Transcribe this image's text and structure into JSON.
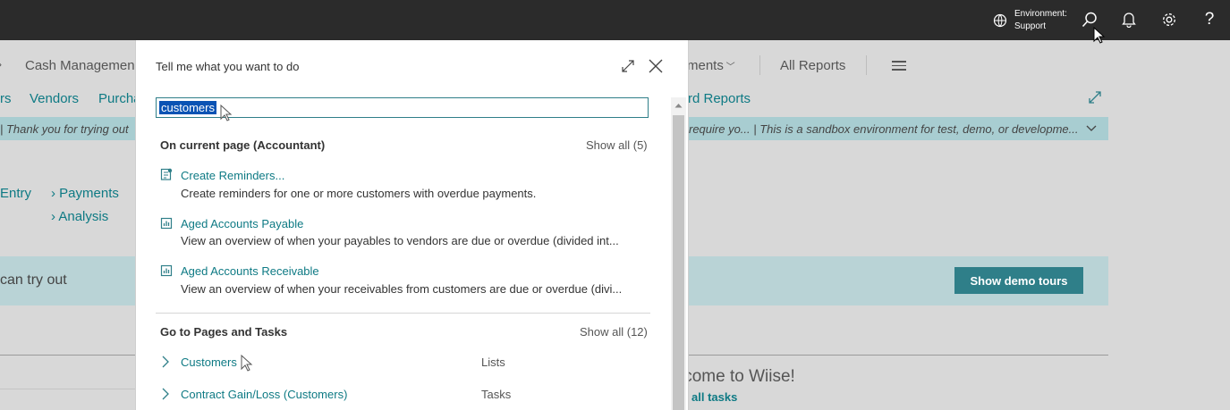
{
  "topbar": {
    "environment_label": "Environment:",
    "environment_value": "Support",
    "icons": [
      "building-icon",
      "search-icon",
      "bell-icon",
      "gear-icon",
      "help-icon"
    ]
  },
  "background": {
    "nav_row1": [
      "Cash Managemen",
      "ments",
      "All Reports"
    ],
    "nav_row2": [
      "rs",
      "Vendors",
      "Purcha",
      "rd Reports"
    ],
    "banner_left": "|  Thank you for trying out",
    "banner_right": "require yo...  |  This is a sandbox environment for test, demo, or developme...",
    "links": [
      "Entry",
      "Payments",
      "Analysis"
    ],
    "demo_text": "can try out",
    "demo_button": "Show demo tours",
    "welcome": "lcome to Wiise!",
    "all_tasks": "all tasks"
  },
  "dialog": {
    "title": "Tell me what you want to do",
    "search_value": "customers",
    "section1": {
      "title": "On current page (Accountant)",
      "show_all": "Show all (5)",
      "results": [
        {
          "title": "Create Reminders...",
          "description": "Create reminders for one or more customers with overdue payments.",
          "icon": "reminder-icon"
        },
        {
          "title": "Aged Accounts Payable",
          "description": "View an overview of when your payables to vendors are due or overdue (divided int...",
          "icon": "report-icon"
        },
        {
          "title": "Aged Accounts Receivable",
          "description": "View an overview of when your receivables from customers are due or overdue (divi...",
          "icon": "report-icon"
        }
      ]
    },
    "section2": {
      "title": "Go to Pages and Tasks",
      "show_all": "Show all (12)",
      "items": [
        {
          "title": "Customers",
          "category": "Lists"
        },
        {
          "title": "Contract Gain/Loss (Customers)",
          "category": "Tasks"
        }
      ]
    }
  },
  "colors": {
    "accent": "#0e7a84",
    "topbar": "#2b2b2b",
    "selection": "#0a53b4",
    "button": "#2f7f89"
  }
}
